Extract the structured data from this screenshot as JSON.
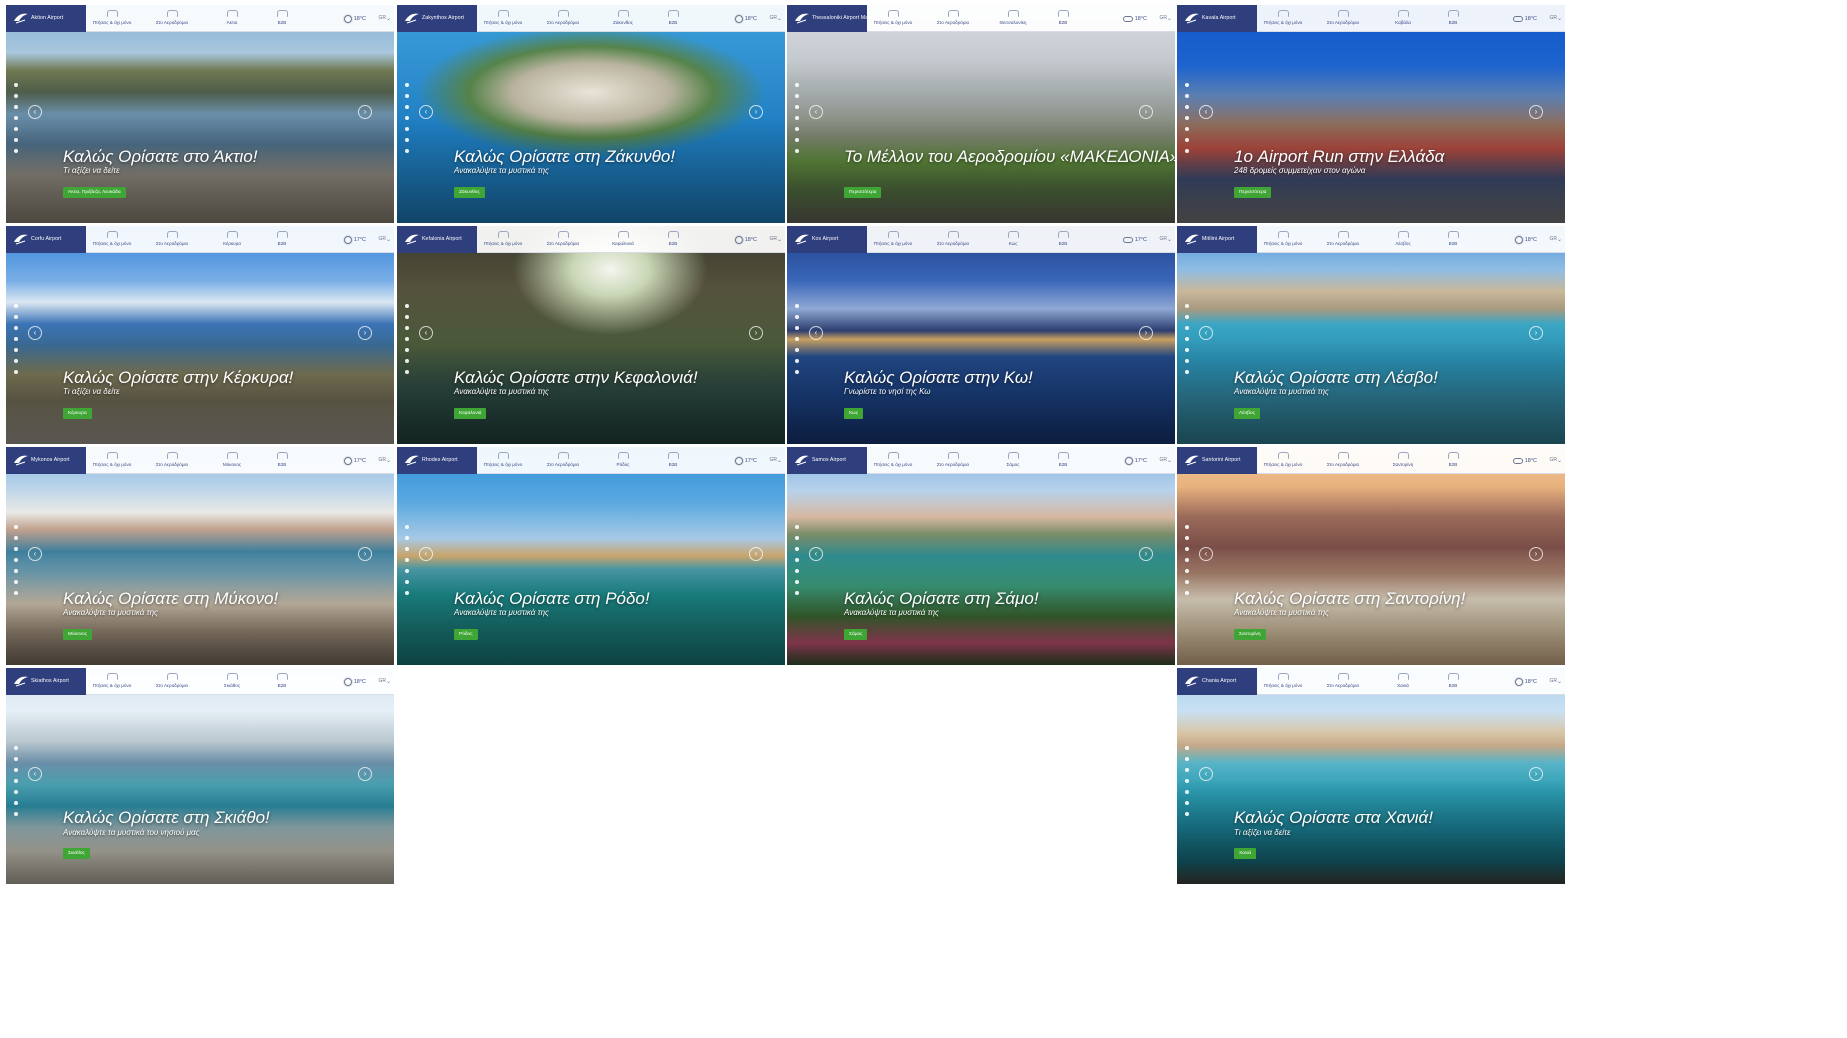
{
  "nav_labels": [
    "Πτήσεις & όχι μόνο",
    "Στο Αεροδρόμιο",
    "",
    "B2B"
  ],
  "lang": "GR",
  "tiles": [
    {
      "airport": "Aktion Airport",
      "temp": "18°C",
      "weather_icon": "sun-icon",
      "nav3": "Άκτιο",
      "title": "Καλώς Ορίσατε στο Άκτιο!",
      "subtitle": "Τι αξίζει να δείτε",
      "tag": "Άκτιο, Πρέβεζα, Λευκάδα",
      "bg": "linear-gradient(180deg,#7fb0d8 0%,#a9c7dd 22%,#6f7a52 30%,#4f5d4a 40%,#6a8ea8 50%,#4d6f88 64%,#8f8a80 78%,#7b7366 100%)"
    },
    {
      "airport": "Zakynthos Airport",
      "temp": "18°C",
      "weather_icon": "sun-icon",
      "nav3": "Ζάκυνθος",
      "title": "Καλώς Ορίσατε στη Ζάκυνθο!",
      "subtitle": "Ανακαλύψτε τα μυστικά της",
      "tag": "Ζάκυνθος",
      "bg": "radial-gradient(ellipse 45% 30% at 50% 40%,#e8e4d8 0%,#b9b39e 45%,rgba(90,130,60,0.9) 70%,rgba(0,0,0,0) 100%),linear-gradient(180deg,#3aa0d8 0%,#2f8fd0 30%,#1f7fc2 55%,#1a6ea8 100%)"
    },
    {
      "airport": "Thessaloniki Airport Makedonia",
      "temp": "18°C",
      "weather_icon": "cloud-icon",
      "nav3": "Θεσσαλονίκη",
      "title": "Το Μέλλον του Αεροδρομίου «ΜΑΚΕΔΟΝΙΑ»",
      "subtitle": "",
      "tag": "Περισσότερα",
      "bg": "linear-gradient(180deg,#d9dde2 0%,#c5cad0 25%,#9aa19f 45%,#7c8470 60%,#5e8a3c 72%,#4f6b3e 85%,#59574f 100%)"
    },
    {
      "airport": "Kavala Airport",
      "temp": "18°C",
      "weather_icon": "cloud-icon",
      "nav3": "Καβάλα",
      "title": "1ο Airport Run στην Ελλάδα",
      "subtitle": "248 δρομείς συμμετείχαν στον αγώνα",
      "tag": "Περισσότερα",
      "bg": "linear-gradient(180deg,#0f57c8 0%,#1e64cf 28%,#5d7fb0 42%,#8f6e5c 55%,#b04a3f 66%,#3c4b6e 80%,#6a6a6a 100%)"
    },
    {
      "airport": "Corfu Airport",
      "temp": "17°C",
      "weather_icon": "sun-icon",
      "nav3": "Κέρκυρα",
      "title": "Καλώς Ορίσατε στην Κέρκυρα!",
      "subtitle": "Τι αξίζει να δείτε",
      "tag": "Κέρκυρα",
      "bg": "linear-gradient(180deg,#2f7fd8 0%,#78aee6 25%,#dbe7f2 35%,#3b73b5 45%,#3a6a92 55%,#7e7a5a 68%,#6f6a55 80%,#8d8a80 100%)"
    },
    {
      "airport": "Kefalonia Airport",
      "temp": "18°C",
      "weather_icon": "sun-icon",
      "nav3": "Κεφαλονιά",
      "title": "Καλώς Ορίσατε στην Κεφαλονιά!",
      "subtitle": "Ανακαλύψτε τα μυστικά της",
      "tag": "Κεφαλονιά",
      "bg": "radial-gradient(ellipse 25% 30% at 55% 20%,#f4f6ef 0%,#c9d6b5 40%,rgba(0,0,0,0) 100%),linear-gradient(180deg,#3a3a2e 0%,#55523c 30%,#4a5a3a 55%,#2d4a44 75%,#1e3934 100%)"
    },
    {
      "airport": "Kos Airport",
      "temp": "17°C",
      "weather_icon": "cloud-icon",
      "nav3": "Κως",
      "title": "Καλώς Ορίσατε στην Κω!",
      "subtitle": "Γνωρίστε το νησί της Κω",
      "tag": "Κως",
      "bg": "linear-gradient(180deg,#1e3f88 0%,#3a66b8 25%,#8fa8d4 38%,#2c3e70 48%,#c9a060 52%,#234a8a 60%,#1a3f7e 80%,#142f64 100%)"
    },
    {
      "airport": "Mitilini Airport",
      "temp": "18°C",
      "weather_icon": "sun-icon",
      "nav3": "Λέσβος",
      "title": "Καλώς Ορίσατε στη Λέσβο!",
      "subtitle": "Ανακαλύψτε τα μυστικά της",
      "tag": "Λέσβος",
      "bg": "linear-gradient(180deg,#4b90d6 0%,#8fbde4 20%,#c9b89a 30%,#a89a80 38%,#3aa6c4 45%,#2a8fb2 62%,#2f7f98 80%,#2a6f80 100%)"
    },
    {
      "airport": "Mykonos Airport",
      "temp": "17°C",
      "weather_icon": "sun-icon",
      "nav3": "Μύκονος",
      "title": "Καλώς Ορίσατε στη Μύκονο!",
      "subtitle": "Ανακαλύψτε τα μυστικά της",
      "tag": "Μύκονος",
      "bg": "linear-gradient(180deg,#7fb3e0 0%,#b9d3ea 18%,#e9e9e6 30%,#c0a08c 38%,#3f7f9c 48%,#6f9cae 58%,#d4c6b2 72%,#9c8c78 85%,#6a5f52 100%)"
    },
    {
      "airport": "Rhodes Airport",
      "temp": "17°C",
      "weather_icon": "sun-icon",
      "nav3": "Ρόδος",
      "title": "Καλώς Ορίσατε στη Ρόδο!",
      "subtitle": "Ανακαλύψτε τα μυστικά της",
      "tag": "Ρόδος",
      "bg": "linear-gradient(180deg,#2b8fd6 0%,#5aa8e0 25%,#a6c9e6 42%,#c9a46a 50%,#4a9aa8 56%,#1c8c8c 68%,#1a7c7a 82%,#156a6a 100%)"
    },
    {
      "airport": "Samos Airport",
      "temp": "17°C",
      "weather_icon": "sun-icon",
      "nav3": "Σάμος",
      "title": "Καλώς Ορίσατε στη Σάμο!",
      "subtitle": "Ανακαλύψτε τα μυστικά της",
      "tag": "Σάμος",
      "bg": "linear-gradient(180deg,#7fb1e0 0%,#b7d2ec 20%,#d6b8a0 32%,#7b8d6a 40%,#2f8a8c 50%,#3b9a7a 64%,#3d6a32 78%,#b44b6a 90%,#2e4a2a 100%)"
    },
    {
      "airport": "Santorini Airport",
      "temp": "18°C",
      "weather_icon": "cloud-icon",
      "nav3": "Σαντορίνη",
      "title": "Καλώς Ορίσατε στη Σαντορίνη!",
      "subtitle": "Ανακαλύψτε τα μυστικά της",
      "tag": "Σαντορίνη",
      "bg": "linear-gradient(180deg,#f0c89a 0%,#e9b27e 18%,#9a6a5a 32%,#7a4e48 46%,#a07a68 58%,#e8dcc8 70%,#d8c6a8 82%,#b89a78 100%)"
    },
    {
      "airport": "Skiathos Airport",
      "temp": "18°C",
      "weather_icon": "sun-icon",
      "nav3": "Σκιάθος",
      "title": "Καλώς Ορίσατε στη Σκιάθο!",
      "subtitle": "Ανακαλύψτε τα μυστικά του νησιού μας",
      "tag": "Σκιάθος",
      "bg": "linear-gradient(180deg,#cfe3f2 0%,#e6eff6 20%,#b9c7cf 34%,#6a8ea8 44%,#4aa0b0 54%,#2c8aa2 64%,#9ab6bc 74%,#c8c4b8 85%,#9c988c 100%)"
    },
    {
      "airport": "Chania Airport",
      "temp": "18°C",
      "weather_icon": "sun-icon",
      "nav3": "Χανιά",
      "title": "Καλώς Ορίσατε στα Χανιά!",
      "subtitle": "Τι αξίζει να δείτε",
      "tag": "Χανιά",
      "bg": "linear-gradient(180deg,#a8d0ee 0%,#c8e0f2 20%,#d8c6a8 30%,#c4a888 36%,#58b4c8 44%,#2a9ab0 58%,#1a7c90 75%,#145e6c 90%,#3a3a34 100%)"
    }
  ]
}
